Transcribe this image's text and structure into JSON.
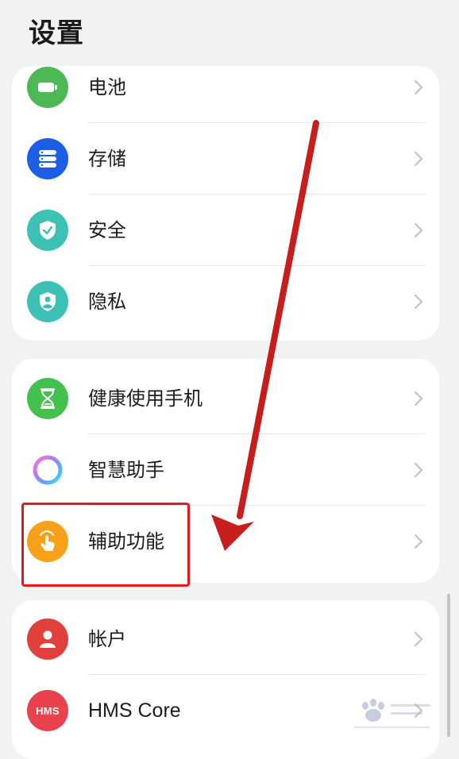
{
  "page": {
    "title": "设置"
  },
  "groups": [
    {
      "items": [
        {
          "label": "电池",
          "icon": "battery-icon",
          "icon_color": "#4cb954"
        },
        {
          "label": "存储",
          "icon": "storage-icon",
          "icon_color": "#1c5ee6"
        },
        {
          "label": "安全",
          "icon": "security-shield-icon",
          "icon_color": "#3ec0b5"
        },
        {
          "label": "隐私",
          "icon": "privacy-shield-icon",
          "icon_color": "#3ec0b5"
        }
      ]
    },
    {
      "items": [
        {
          "label": "健康使用手机",
          "icon": "hourglass-icon",
          "icon_color": "#44c04e"
        },
        {
          "label": "智慧助手",
          "icon": "assistant-ring-icon",
          "icon_color": "#b27bf0"
        },
        {
          "label": "辅助功能",
          "icon": "hand-tap-icon",
          "icon_color": "#f7a11b"
        }
      ]
    },
    {
      "items": [
        {
          "label": "帐户",
          "icon": "account-icon",
          "icon_color": "#e2403c"
        },
        {
          "label": "HMS Core",
          "icon": "hms-icon",
          "icon_color": "#e8434d",
          "icon_text": "HMS"
        }
      ]
    }
  ],
  "annotation": {
    "highlight_color": "#e41b1b",
    "arrow_color": "#c81d1d"
  },
  "watermark": {
    "icon": "baidu-paw-icon"
  },
  "colors": {
    "background": "#f1f2f4",
    "card": "#ffffff",
    "chevron": "#c3c3c6"
  }
}
